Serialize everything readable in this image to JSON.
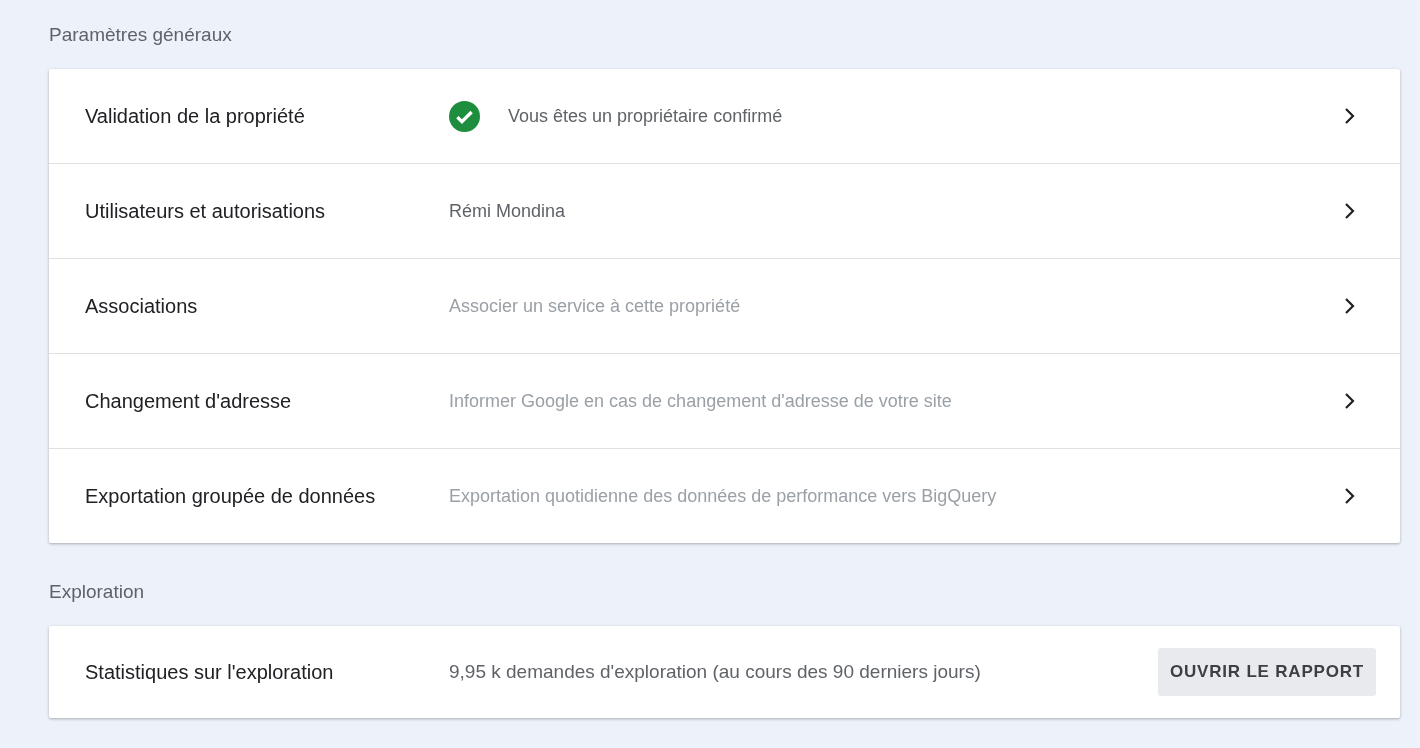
{
  "sections": [
    {
      "title": "Paramètres généraux",
      "rows": [
        {
          "label": "Validation de la propriété",
          "kind": "status",
          "text": "Vous êtes un propriétaire confirmé"
        },
        {
          "label": "Utilisateurs et autorisations",
          "kind": "value",
          "text": "Rémi Mondina"
        },
        {
          "label": "Associations",
          "kind": "hint",
          "text": "Associer un service à cette propriété"
        },
        {
          "label": "Changement d'adresse",
          "kind": "hint",
          "text": "Informer Google en cas de changement d'adresse de votre site"
        },
        {
          "label": "Exportation groupée de données",
          "kind": "hint",
          "text": "Exportation quotidienne des données de performance vers BigQuery"
        }
      ]
    },
    {
      "title": "Exploration",
      "rows": [
        {
          "label": "Statistiques sur l'exploration",
          "kind": "report",
          "text": "9,95 k demandes d'exploration (au cours des 90 derniers jours)",
          "button": "OUVRIR LE RAPPORT"
        }
      ]
    }
  ]
}
